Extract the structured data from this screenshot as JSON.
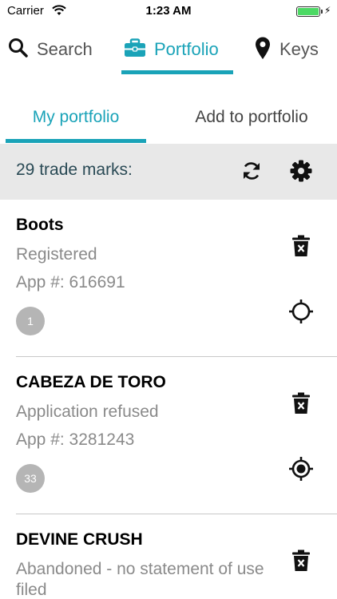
{
  "status_bar": {
    "carrier": "Carrier",
    "time": "1:23 AM",
    "battery_level": 1.0
  },
  "top_nav": {
    "items": [
      {
        "label": "Search",
        "icon": "search-icon"
      },
      {
        "label": "Portfolio",
        "icon": "briefcase-icon",
        "active": true
      },
      {
        "label": "Keys",
        "icon": "map-pin-icon"
      }
    ]
  },
  "sub_tabs": {
    "items": [
      {
        "label": "My portfolio",
        "active": true
      },
      {
        "label": "Add to portfolio"
      }
    ]
  },
  "portfolio": {
    "count_label": "29 trade marks:",
    "refresh_icon": "refresh-icon",
    "settings_icon": "gear-icon",
    "items": [
      {
        "name": "Boots",
        "status": "Registered",
        "app": "App #: 616691",
        "badge": "1",
        "target": "crosshair-icon"
      },
      {
        "name": "CABEZA DE TORO",
        "status": "Application refused",
        "app": "App #: 3281243",
        "badge": "33",
        "target": "crosshair-filled-icon"
      },
      {
        "name": "DEVINE CRUSH",
        "status": "Abandoned - no statement of use filed",
        "app": "",
        "badge": "",
        "target": ""
      }
    ]
  },
  "colors": {
    "accent": "#1aa3b8",
    "count_bar_bg": "#e8e8e8",
    "secondary_text": "#8a8a8a",
    "badge_bg": "#b5b5b5"
  }
}
